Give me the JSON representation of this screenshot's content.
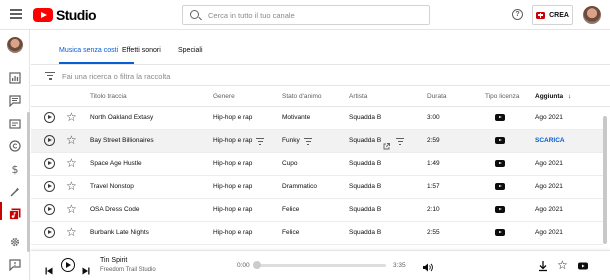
{
  "app": {
    "logo_text": "Studio",
    "search_placeholder": "Cerca in tutto il tuo canale",
    "help_glyph": "?",
    "create_label": "CREA"
  },
  "tabs": [
    {
      "label": "Musica senza costi",
      "active": true
    },
    {
      "label": "Effetti sonori",
      "active": false
    },
    {
      "label": "Speciali",
      "active": false
    }
  ],
  "filter": {
    "placeholder": "Fai una ricerca o filtra la raccolta"
  },
  "table": {
    "headers": {
      "title": "Titolo traccia",
      "genre": "Genere",
      "mood": "Stato d'animo",
      "artist": "Artista",
      "duration": "Durata",
      "license": "Tipo licenza",
      "added": "Aggiunta"
    },
    "sort_indicator": "↓",
    "rows": [
      {
        "title": "North Oakland Extasy",
        "genre": "Hip-hop e rap",
        "mood": "Motivante",
        "artist": "Squadda B",
        "duration": "3:00",
        "added": "Ago 2021"
      },
      {
        "title": "Bay Street Billionaires",
        "genre": "Hip-hop e rap",
        "mood": "Funky",
        "artist": "Squadda B",
        "duration": "2:59",
        "added": "SCARICA"
      },
      {
        "title": "Space Age Hustle",
        "genre": "Hip-hop e rap",
        "mood": "Cupo",
        "artist": "Squadda B",
        "duration": "1:49",
        "added": "Ago 2021"
      },
      {
        "title": "Travel Nonstop",
        "genre": "Hip-hop e rap",
        "mood": "Drammatico",
        "artist": "Squadda B",
        "duration": "1:57",
        "added": "Ago 2021"
      },
      {
        "title": "OSA Dress Code",
        "genre": "Hip-hop e rap",
        "mood": "Felice",
        "artist": "Squadda B",
        "duration": "2:10",
        "added": "Ago 2021"
      },
      {
        "title": "Burbank Late Nights",
        "genre": "Hip-hop e rap",
        "mood": "Felice",
        "artist": "Squadda B",
        "duration": "2:55",
        "added": "Ago 2021"
      }
    ],
    "hover_row_index": 1
  },
  "player": {
    "track_title": "Tin Spirit",
    "track_artist": "Freedom Trail Studio",
    "time_current": "0:00",
    "time_total": "3:35",
    "progress_fraction": 0.0
  },
  "colors": {
    "brand_red": "#ff0000",
    "accent_blue": "#065fd4",
    "active_nav": "#cc0000"
  },
  "icons": {
    "sidebar": [
      "dashboard-icon",
      "comments-icon",
      "subtitles-icon",
      "copyright-icon",
      "monetization-icon",
      "customization-icon",
      "audio-library-icon",
      "settings-icon",
      "feedback-icon"
    ]
  }
}
